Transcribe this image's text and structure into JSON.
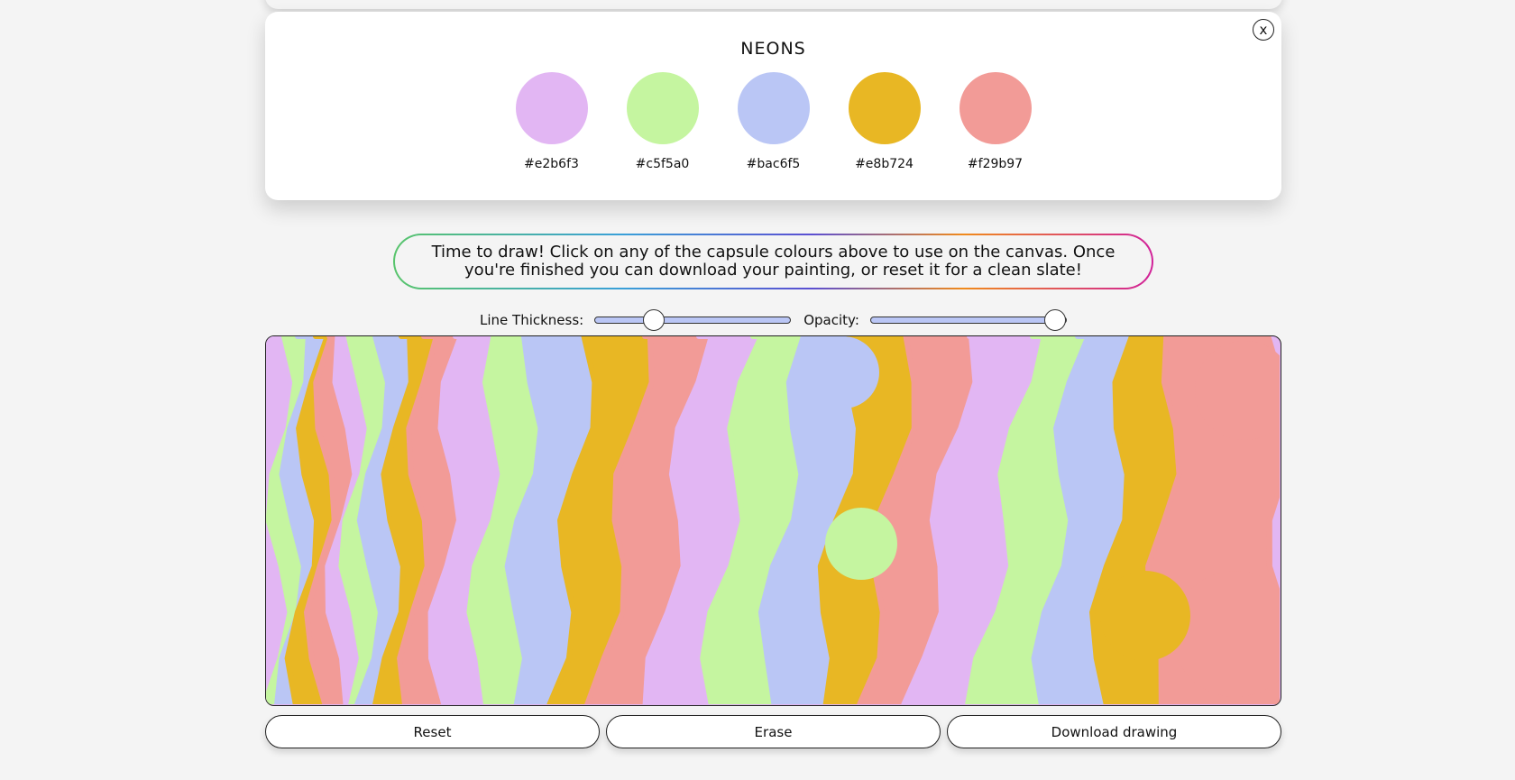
{
  "palette": {
    "title": "NEONS",
    "close_label": "x",
    "swatches": [
      {
        "hex": "#e2b6f3"
      },
      {
        "hex": "#c5f5a0"
      },
      {
        "hex": "#bac6f5"
      },
      {
        "hex": "#e8b724"
      },
      {
        "hex": "#f29b97"
      }
    ]
  },
  "instructions": "Time to draw! Click on any of the capsule colours above to use on the canvas. Once you're finished you can download your painting, or reset it for a clean slate!",
  "controls": {
    "thickness_label": "Line Thickness:",
    "thickness_value": 0.28,
    "opacity_label": "Opacity:",
    "opacity_value": 1.0
  },
  "buttons": {
    "reset": "Reset",
    "erase": "Erase",
    "download": "Download drawing"
  },
  "canvas": {
    "stripe_colors": [
      "#e2b6f3",
      "#c5f5a0",
      "#bac6f5",
      "#e8b724",
      "#f29b97"
    ]
  }
}
